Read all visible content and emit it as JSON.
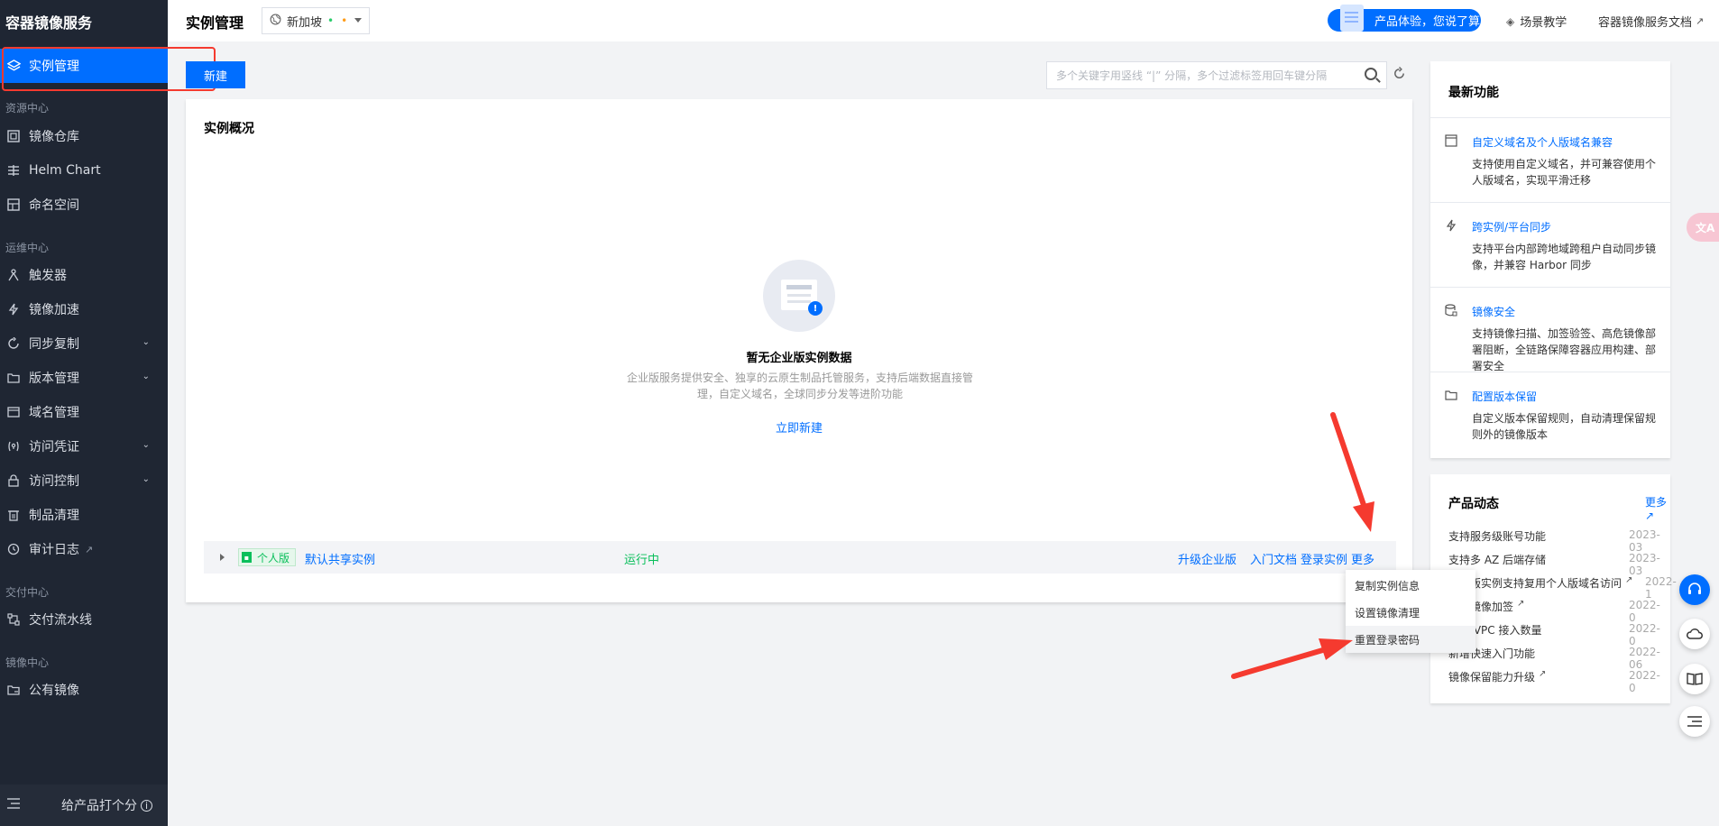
{
  "sidebar": {
    "title": "容器镜像服务",
    "active_item": "实例管理",
    "groups": {
      "resource": "资源中心",
      "ops": "运维中心",
      "delivery": "交付中心",
      "image": "镜像中心"
    },
    "items": [
      {
        "label": "镜像仓库",
        "icon": "repository-icon"
      },
      {
        "label": "Helm Chart",
        "icon": "helm-icon"
      },
      {
        "label": "命名空间",
        "icon": "namespace-icon"
      },
      {
        "label": "触发器",
        "icon": "trigger-icon"
      },
      {
        "label": "镜像加速",
        "icon": "lightning-icon"
      },
      {
        "label": "同步复制",
        "icon": "sync-icon"
      },
      {
        "label": "版本管理",
        "icon": "folder-icon"
      },
      {
        "label": "域名管理",
        "icon": "domain-icon"
      },
      {
        "label": "访问凭证",
        "icon": "credential-icon"
      },
      {
        "label": "访问控制",
        "icon": "lock-icon"
      },
      {
        "label": "制品清理",
        "icon": "trash-icon"
      },
      {
        "label": "审计日志",
        "icon": "history-icon"
      },
      {
        "label": "交付流水线",
        "icon": "pipeline-icon"
      },
      {
        "label": "公有镜像",
        "icon": "public-image-icon"
      }
    ],
    "feedback": "给产品打个分"
  },
  "header": {
    "title": "实例管理",
    "region": "新加坡",
    "promo": "产品体验，您说了算",
    "links": {
      "tutorial": "场景教学",
      "docs": "容器镜像服务文档"
    }
  },
  "toolbar": {
    "new_button": "新建",
    "search_placeholder": "多个关键字用竖线 “|” 分隔，多个过滤标签用回车键分隔"
  },
  "overview": {
    "title": "实例概况",
    "empty_title": "暂无企业版实例数据",
    "empty_desc": "企业版服务提供安全、独享的云原生制品托管服务，支持后端数据直接管理，自定义域名，全球同步分发等进阶功能",
    "empty_link": "立即新建"
  },
  "instance_row": {
    "tag": "个人版",
    "name": "默认共享实例",
    "status": "运行中",
    "actions": {
      "upgrade": "升级企业版",
      "docs": "入门文档",
      "login": "登录实例",
      "more": "更多"
    }
  },
  "more_menu": [
    "复制实例信息",
    "设置镜像清理",
    "重置登录密码"
  ],
  "latest": {
    "title": "最新功能",
    "features": [
      {
        "name": "自定义域名及个人版域名兼容",
        "desc": "支持使用自定义域名，并可兼容使用个人版域名，实现平滑迁移",
        "icon": "window-icon"
      },
      {
        "name": "跨实例/平台同步",
        "desc": "支持平台内部跨地域跨租户自动同步镜像，并兼容 Harbor 同步",
        "icon": "lightning-icon"
      },
      {
        "name": "镜像安全",
        "desc": "支持镜像扫描、加签验签、高危镜像部署阻断，全链路保障容器应用构建、部署安全",
        "icon": "database-lock-icon"
      },
      {
        "name": "配置版本保留",
        "desc": "自定义版本保留规则，自动清理保留规则外的镜像版本",
        "icon": "folder-icon"
      }
    ]
  },
  "news": {
    "title": "产品动态",
    "more": "更多",
    "items": [
      {
        "text": "支持服务级账号功能",
        "date": "2023-03",
        "ext": false
      },
      {
        "text": "支持多 AZ 后端存储",
        "date": "2023-03",
        "ext": false
      },
      {
        "text": "企业版实例支持复用个人版域名访问",
        "date": "2022-1",
        "ext": true
      },
      {
        "text": "支持镜像加签",
        "date": "2022-0",
        "ext": true
      },
      {
        "text": "支持 VPC 接入数量",
        "date": "2022-0",
        "ext": false
      },
      {
        "text": "新增快速入门功能",
        "date": "2022-06",
        "ext": false
      },
      {
        "text": "镜像保留能力升级",
        "date": "2022-0",
        "ext": true
      }
    ]
  },
  "float_icons": [
    "headset-icon",
    "cloud-icon",
    "book-icon",
    "list-icon"
  ],
  "colors": {
    "primary": "#006eff",
    "sidebar_bg": "#1f2633",
    "success": "#0abf5b",
    "annotation_red": "#f53a2f"
  }
}
